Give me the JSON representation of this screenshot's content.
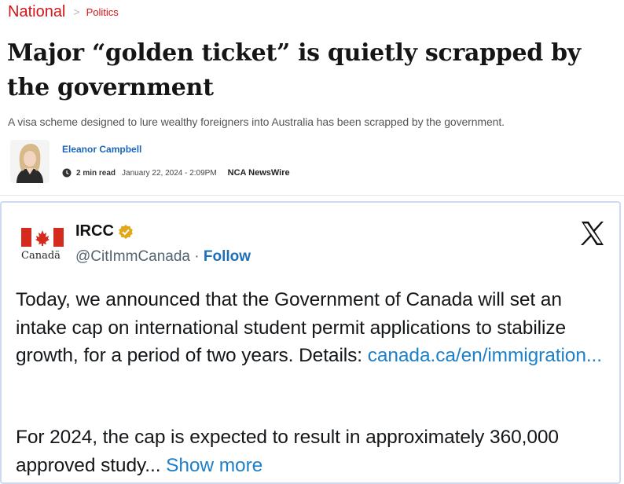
{
  "breadcrumb": {
    "section": "National",
    "subsection": "Politics"
  },
  "article": {
    "headline": "Major “golden ticket” is quietly scrapped by the government",
    "standfirst": "A visa scheme designed to lure wealthy foreigners into Australia has been scrapped by the government.",
    "author": "Eleanor Campbell",
    "read_time": "2 min read",
    "date": "January 22, 2024 - 2:09PM",
    "source": "NCA NewsWire"
  },
  "tweet": {
    "account_name": "IRCC",
    "logo_word": "Canadä",
    "handle": "@CitImmCanada",
    "separator": " · ",
    "follow_label": "Follow",
    "para1": "Today, we announced that the Government of Canada will set an intake cap on international student permit applications to stabilize growth, for a period of two years. Details: ",
    "link": "canada.ca/en/immigration...",
    "para2": "For 2024, the cap is expected to result in approximately 360,000 approved study... ",
    "show_more": "Show more"
  },
  "icons": {
    "clock": "clock-icon",
    "verified": "verified-badge-icon",
    "x": "x-logo-icon",
    "flag": "canada-flag-icon"
  },
  "colors": {
    "accent_red": "#d31418",
    "author_blue": "#1b66b8",
    "link_blue": "#1d80c8",
    "verified_gold": "#e2a81b"
  }
}
